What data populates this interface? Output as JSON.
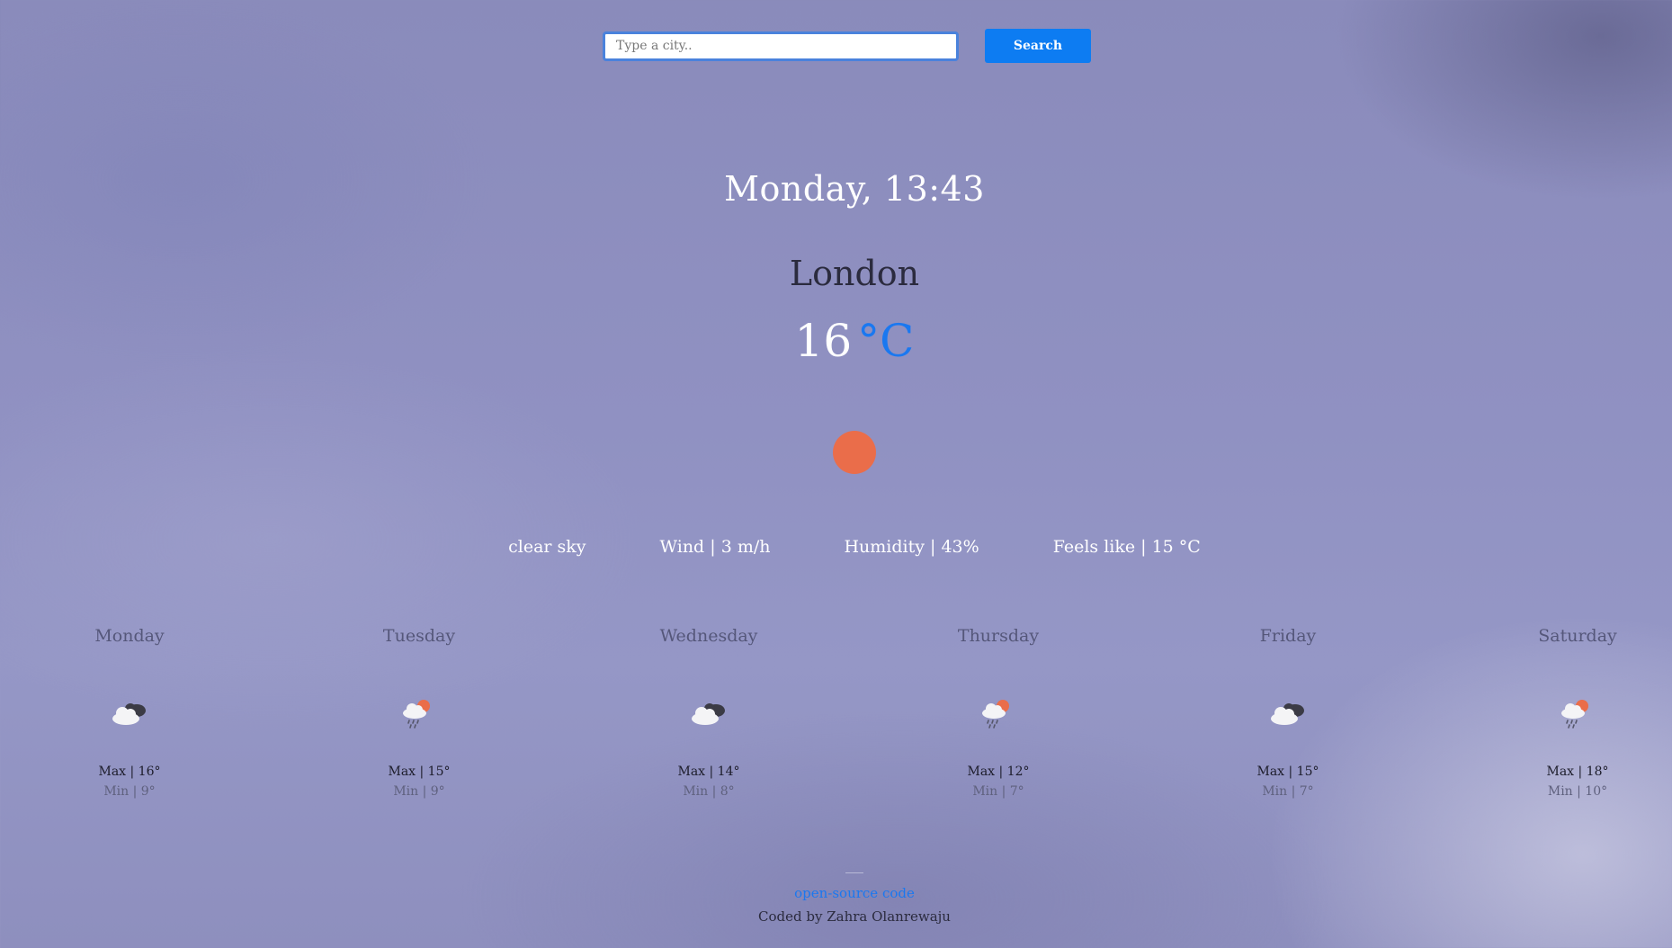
{
  "search": {
    "placeholder": "Type a city..",
    "button_label": "Search"
  },
  "current": {
    "datetime": "Monday, 13:43",
    "city": "London",
    "temperature": "16",
    "unit": "°C",
    "icon": "sun-icon",
    "description": "clear sky",
    "wind": "Wind | 3 m/h",
    "humidity": "Humidity | 43%",
    "feels_like": "Feels like | 15 °C"
  },
  "forecast": [
    {
      "day": "Monday",
      "icon": "broken-clouds-icon",
      "max": "Max | 16°",
      "min": "Min | 9°"
    },
    {
      "day": "Tuesday",
      "icon": "rain-sun-icon",
      "max": "Max | 15°",
      "min": "Min | 9°"
    },
    {
      "day": "Wednesday",
      "icon": "broken-clouds-icon",
      "max": "Max | 14°",
      "min": "Min | 8°"
    },
    {
      "day": "Thursday",
      "icon": "rain-sun-icon",
      "max": "Max | 12°",
      "min": "Min | 7°"
    },
    {
      "day": "Friday",
      "icon": "broken-clouds-icon",
      "max": "Max | 15°",
      "min": "Min | 7°"
    },
    {
      "day": "Saturday",
      "icon": "rain-sun-icon",
      "max": "Max | 18°",
      "min": "Min | 10°"
    }
  ],
  "footer": {
    "link": "open-source code",
    "credit": "Coded by Zahra Olanrewaju"
  },
  "colors": {
    "accent": "#0d7cf2",
    "sun": "#ea6d4a"
  }
}
